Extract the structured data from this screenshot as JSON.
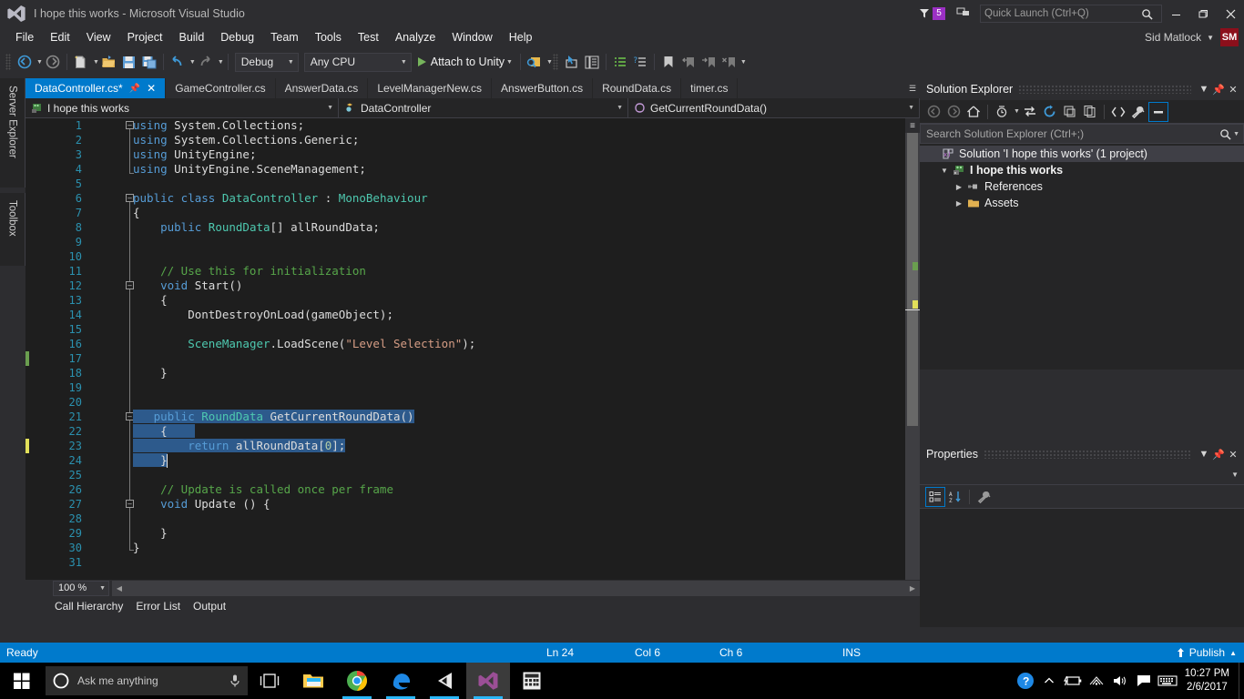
{
  "titlebar": {
    "app_icon": "visual-studio-logo",
    "title": "I hope this works - Microsoft Visual Studio",
    "notification_count": "5",
    "quick_launch_placeholder": "Quick Launch (Ctrl+Q)",
    "quick_launch_value": "",
    "minimize_label": "–",
    "restore_label": "❐",
    "close_label": "✕",
    "account_name": "Sid Matlock",
    "account_initials": "SM"
  },
  "menubar": {
    "items": [
      "File",
      "Edit",
      "View",
      "Project",
      "Build",
      "Debug",
      "Team",
      "Tools",
      "Test",
      "Analyze",
      "Window",
      "Help"
    ]
  },
  "toolbar": {
    "configuration": "Debug",
    "platform": "Any CPU",
    "attach_label": "Attach to Unity"
  },
  "leftdock": {
    "tabs": [
      "Server Explorer",
      "Toolbox"
    ]
  },
  "editor": {
    "tabs": [
      {
        "label": "DataController.cs*",
        "active": true
      },
      {
        "label": "GameController.cs",
        "active": false
      },
      {
        "label": "AnswerData.cs",
        "active": false
      },
      {
        "label": "LevelManagerNew.cs",
        "active": false
      },
      {
        "label": "AnswerButton.cs",
        "active": false
      },
      {
        "label": "RoundData.cs",
        "active": false
      },
      {
        "label": "timer.cs",
        "active": false
      }
    ],
    "navbar": {
      "project": "I hope this works",
      "type": "DataController",
      "member": "GetCurrentRoundData()"
    },
    "zoom_level": "100 %",
    "line_count": 31,
    "lines": [
      {
        "n": 1,
        "text": "using System.Collections;"
      },
      {
        "n": 2,
        "text": "using System.Collections.Generic;"
      },
      {
        "n": 3,
        "text": "using UnityEngine;"
      },
      {
        "n": 4,
        "text": "using UnityEngine.SceneManagement;"
      },
      {
        "n": 5,
        "text": ""
      },
      {
        "n": 6,
        "text": "public class DataController : MonoBehaviour"
      },
      {
        "n": 7,
        "text": "{"
      },
      {
        "n": 8,
        "text": "    public RoundData[] allRoundData;"
      },
      {
        "n": 9,
        "text": ""
      },
      {
        "n": 10,
        "text": ""
      },
      {
        "n": 11,
        "text": "    // Use this for initialization"
      },
      {
        "n": 12,
        "text": "    void Start()"
      },
      {
        "n": 13,
        "text": "    {"
      },
      {
        "n": 14,
        "text": "        DontDestroyOnLoad(gameObject);"
      },
      {
        "n": 15,
        "text": ""
      },
      {
        "n": 16,
        "text": "        SceneManager.LoadScene(\"Level Selection\");"
      },
      {
        "n": 17,
        "text": ""
      },
      {
        "n": 18,
        "text": "    }"
      },
      {
        "n": 19,
        "text": ""
      },
      {
        "n": 20,
        "text": ""
      },
      {
        "n": 21,
        "text": "    public RoundData GetCurrentRoundData()"
      },
      {
        "n": 22,
        "text": "    {"
      },
      {
        "n": 23,
        "text": "        return allRoundData[0];"
      },
      {
        "n": 24,
        "text": "    }"
      },
      {
        "n": 25,
        "text": ""
      },
      {
        "n": 26,
        "text": "    // Update is called once per frame"
      },
      {
        "n": 27,
        "text": "    void Update () {"
      },
      {
        "n": 28,
        "text": ""
      },
      {
        "n": 29,
        "text": "    }"
      },
      {
        "n": 30,
        "text": "}"
      },
      {
        "n": 31,
        "text": ""
      }
    ]
  },
  "bottom_tabs": [
    "Call Hierarchy",
    "Error List",
    "Output"
  ],
  "solution_explorer": {
    "title": "Solution Explorer",
    "search_placeholder": "Search Solution Explorer (Ctrl+;)",
    "search_value": "",
    "tree": [
      {
        "label": "Solution 'I hope this works' (1 project)",
        "indent": 0,
        "icon": "solution-icon",
        "expander": "",
        "bold": false,
        "selected": true
      },
      {
        "label": "I hope this works",
        "indent": 1,
        "icon": "csharp-project-icon",
        "expander": "open",
        "bold": true,
        "selected": false
      },
      {
        "label": "References",
        "indent": 2,
        "icon": "references-icon",
        "expander": "closed",
        "bold": false,
        "selected": false
      },
      {
        "label": "Assets",
        "indent": 2,
        "icon": "folder-icon",
        "expander": "closed",
        "bold": false,
        "selected": false
      }
    ]
  },
  "properties": {
    "title": "Properties",
    "selected_object": ""
  },
  "statusbar": {
    "status": "Ready",
    "line": "Ln 24",
    "column": "Col 6",
    "character": "Ch 6",
    "insert_mode": "INS",
    "publish": "Publish"
  },
  "taskbar": {
    "search_placeholder": "Ask me anything",
    "apps": [
      "task-view-icon",
      "file-explorer-icon",
      "chrome-icon",
      "edge-icon",
      "unity-icon",
      "visual-studio-icon",
      "calculator-icon"
    ],
    "time": "10:27 PM",
    "date": "2/6/2017"
  },
  "colors": {
    "accent": "#007acc",
    "editor_bg": "#1e1e1e",
    "chrome_bg": "#2d2d30",
    "selection": "#2d5a8c",
    "keyword": "#569cd6",
    "type": "#4ec9b0",
    "comment": "#57a64a",
    "string": "#d69d85",
    "linenumber": "#2b91af"
  }
}
